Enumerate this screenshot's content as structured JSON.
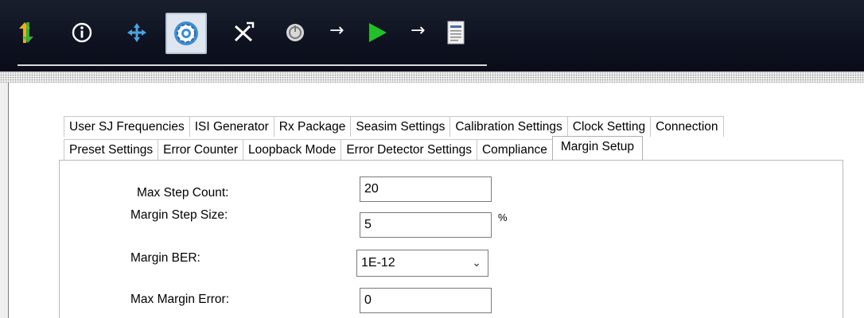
{
  "toolbar": {
    "icons": [
      "sort-arrows-icon",
      "info-icon",
      "move-crosshair-icon",
      "settings-gear-icon",
      "tools-icon",
      "power-icon",
      "flow-arrow-icon",
      "run-play-icon",
      "flow-arrow-icon",
      "report-document-icon"
    ],
    "arrow_glyph": "→",
    "selected": "settings-gear-icon"
  },
  "tabs": {
    "row1": [
      "User SJ Frequencies",
      "ISI Generator",
      "Rx Package",
      "Seasim Settings",
      "Calibration Settings",
      "Clock Setting",
      "Connection"
    ],
    "row2": [
      "Preset Settings",
      "Error Counter",
      "Loopback Mode",
      "Error Detector Settings",
      "Compliance",
      "Margin Setup"
    ],
    "active": "Margin Setup"
  },
  "form": {
    "max_step_count_label": "Max Step Count:",
    "max_step_count_value": "20",
    "margin_step_size_label": "Margin Step Size:",
    "margin_step_size_value": "5",
    "margin_step_size_unit": "%",
    "margin_ber_label": "Margin BER:",
    "margin_ber_value": "1E-12",
    "max_margin_error_label": "Max Margin Error:",
    "max_margin_error_value": "0"
  },
  "colors": {
    "toolbar_bg": "#0e1220",
    "play_green": "#22c02a",
    "icon_blue": "#4aa3e0"
  }
}
